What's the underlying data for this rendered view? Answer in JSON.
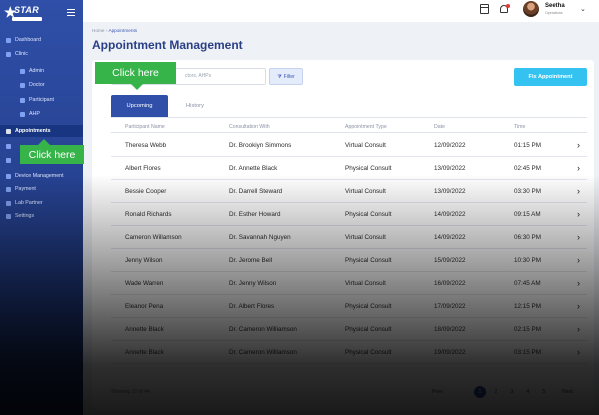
{
  "brand": {
    "logo_text": "STAR",
    "logo_icon": "star-logo-icon"
  },
  "sidebar": {
    "items": [
      {
        "label": "Dashboard",
        "icon": "home-icon"
      },
      {
        "label": "Clinic",
        "icon": "clinic-icon"
      },
      {
        "label": "Admin",
        "icon": "admin-icon"
      },
      {
        "label": "Doctor",
        "icon": "doctor-icon"
      },
      {
        "label": "Participant",
        "icon": "participant-icon"
      },
      {
        "label": "AHP",
        "icon": "ahp-icon"
      },
      {
        "label": "Appointments",
        "icon": "calendar-icon"
      },
      {
        "label": "",
        "icon": "schedule-icon"
      },
      {
        "label": "",
        "icon": "chat-icon"
      },
      {
        "label": "Device Management",
        "icon": "device-icon"
      },
      {
        "label": "Payment",
        "icon": "payment-icon"
      },
      {
        "label": "Lab Partner",
        "icon": "lab-icon"
      },
      {
        "label": "Settings",
        "icon": "settings-icon"
      }
    ]
  },
  "topbar": {
    "user_name": "Seetha",
    "user_role": "Operations"
  },
  "breadcrumb": {
    "home": "Home",
    "sep": " › ",
    "current": "Appointments"
  },
  "page": {
    "title": "Appointment Management"
  },
  "toolbar": {
    "search_placeholder": "ctors, AHPs",
    "filter_label": "Filter",
    "fix_label": "Fix Appointment"
  },
  "tabs": {
    "upcoming": "Upcoming",
    "history": "History"
  },
  "table": {
    "columns": [
      "Participant Name",
      "Consultation With",
      "Appointment Type",
      "Date",
      "Time"
    ],
    "rows": [
      [
        "Theresa Webb",
        "Dr. Brookiyn Simmons",
        "Virtual Consult",
        "12/09/2022",
        "01:15 PM"
      ],
      [
        "Albert Flores",
        "Dr. Annette Black",
        "Physical Consult",
        "13/09/2022",
        "02:45 PM"
      ],
      [
        "Bessie Cooper",
        "Dr. Darrell Steward",
        "Virtual Consult",
        "13/09/2022",
        "03:30 PM"
      ],
      [
        "Ronald Richards",
        "Dr. Esther Howard",
        "Physical Consult",
        "14/09/2022",
        "09:15 AM"
      ],
      [
        "Cameron Willamson",
        "Dr. Savannah Nguyen",
        "Virtual Consult",
        "14/09/2022",
        "06:30 PM"
      ],
      [
        "Jenny Wilson",
        "Dr. Jerome Bell",
        "Physical Consult",
        "15/09/2022",
        "10:30 PM"
      ],
      [
        "Wade Warren",
        "Dr. Jenny Wilson",
        "Virtual Consult",
        "16/09/2022",
        "07:45 AM"
      ],
      [
        "Eleanor Pena",
        "Dr. Albert Flores",
        "Physical Consult",
        "17/09/2022",
        "12:15 PM"
      ],
      [
        "Annette Black",
        "Dr. Cameron Williamson",
        "Physical Consult",
        "18/09/2022",
        "02:15 PM"
      ],
      [
        "Annette Black",
        "Dr. Cameron Williamson",
        "Physical Consult",
        "19/09/2022",
        "03:15 PM"
      ]
    ]
  },
  "pagination": {
    "summary": "Showing 10 of 44",
    "prev": "Prev",
    "next": "Next",
    "pages": [
      "1",
      "2",
      "3",
      "4",
      "5"
    ]
  },
  "hints": {
    "first": "Click here",
    "second": "Click here"
  },
  "colors": {
    "sidebar": "#2f4fa8",
    "accent": "#34c3f0",
    "hint": "#36b44a",
    "title": "#2a3f86"
  }
}
